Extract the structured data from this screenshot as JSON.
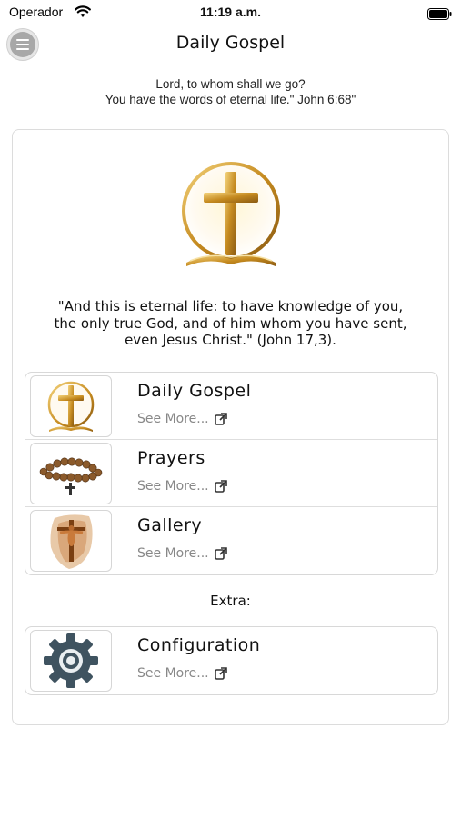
{
  "status_bar": {
    "carrier": "Operador",
    "time": "11:19 a.m."
  },
  "header": {
    "title": "Daily Gospel",
    "quote_line1": "Lord, to whom shall we go?",
    "quote_line2": "You have the words of eternal life.\" John 6:68\""
  },
  "card": {
    "verse_line1": "\"And this is eternal life: to have knowledge of you,",
    "verse_line2": "the only true God, and of him whom you have sent,",
    "verse_line3": "even Jesus Christ.\" (John 17,3).",
    "items": [
      {
        "title": "Daily Gospel",
        "more": "See More...",
        "icon": "cross-icon"
      },
      {
        "title": "Prayers",
        "more": "See More...",
        "icon": "rosary-icon"
      },
      {
        "title": "Gallery",
        "more": "See More...",
        "icon": "crucifix-icon"
      }
    ],
    "extra_label": "Extra:",
    "extra_items": [
      {
        "title": "Configuration",
        "more": "See More...",
        "icon": "gear-icon"
      }
    ]
  },
  "colors": {
    "gold": "#c9962a",
    "gear": "#3f5360",
    "link_gray": "#888888"
  }
}
